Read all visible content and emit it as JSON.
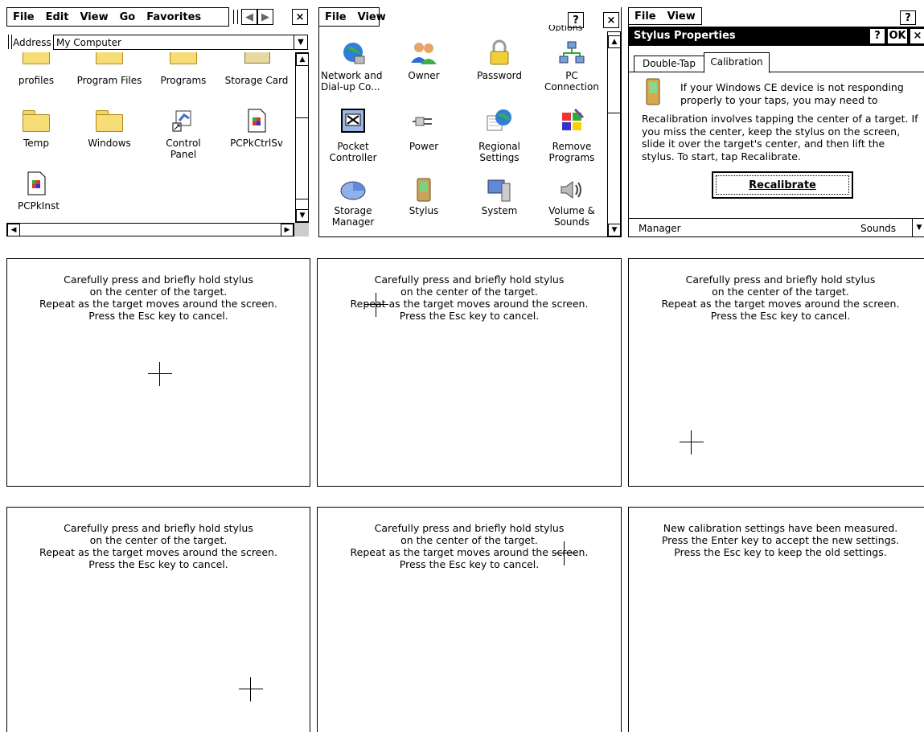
{
  "explorer": {
    "menu": [
      "File",
      "Edit",
      "View",
      "Go",
      "Favorites"
    ],
    "address_label": "Address",
    "address_value": "My Computer",
    "items": [
      {
        "label": "profiles",
        "icon": "folder-icon"
      },
      {
        "label": "Program Files",
        "icon": "folder-icon"
      },
      {
        "label": "Programs",
        "icon": "folder-icon"
      },
      {
        "label": "Storage Card",
        "icon": "storage-card-icon"
      },
      {
        "label": "Temp",
        "icon": "folder-icon"
      },
      {
        "label": "Windows",
        "icon": "folder-icon"
      },
      {
        "label": "Control\nPanel",
        "icon": "control-panel-icon"
      },
      {
        "label": "PCPkCtrlSv",
        "icon": "file-icon"
      },
      {
        "label": "PCPkInst",
        "icon": "file-icon"
      }
    ],
    "close_label": "×"
  },
  "control_panel": {
    "menu": [
      "File",
      "View"
    ],
    "help_label": "?",
    "close_label": "×",
    "partial_top_label": "Options",
    "items": [
      {
        "label": "Network and\nDial-up Co...",
        "icon": "network-icon"
      },
      {
        "label": "Owner",
        "icon": "owner-icon"
      },
      {
        "label": "Password",
        "icon": "password-icon"
      },
      {
        "label": "PC\nConnection",
        "icon": "pc-connection-icon"
      },
      {
        "label": "Pocket\nController",
        "icon": "pocket-controller-icon"
      },
      {
        "label": "Power",
        "icon": "power-icon"
      },
      {
        "label": "Regional\nSettings",
        "icon": "regional-settings-icon"
      },
      {
        "label": "Remove\nPrograms",
        "icon": "remove-programs-icon"
      },
      {
        "label": "Storage\nManager",
        "icon": "storage-manager-icon"
      },
      {
        "label": "Stylus",
        "icon": "stylus-icon"
      },
      {
        "label": "System",
        "icon": "system-icon"
      },
      {
        "label": "Volume &\nSounds",
        "icon": "volume-icon"
      }
    ]
  },
  "stylus_properties": {
    "menu": [
      "File",
      "View"
    ],
    "help_label": "?",
    "title": "Stylus Properties",
    "ok_label": "OK",
    "close_label": "×",
    "tabs": [
      "Double-Tap",
      "Calibration"
    ],
    "info_text": "If your Windows CE device is not responding properly to your taps, you may need to",
    "body_text": "Recalibration involves tapping the center of a target. If you miss the center, keep the stylus on the screen, slide it over the target's center, and then lift the stylus. To start, tap Recalibrate.",
    "recalibrate_label": "Recalibrate",
    "bottom_left": "Manager",
    "bottom_right": "Sounds"
  },
  "calibration": {
    "instructions": "Carefully press and briefly hold stylus\non the center of the target.\nRepeat as the target moves around the screen.\nPress the Esc key to cancel.",
    "done_text": "New calibration settings have been measured.\nPress the Enter key to accept the new settings.\nPress the Esc key to keep the old settings."
  }
}
